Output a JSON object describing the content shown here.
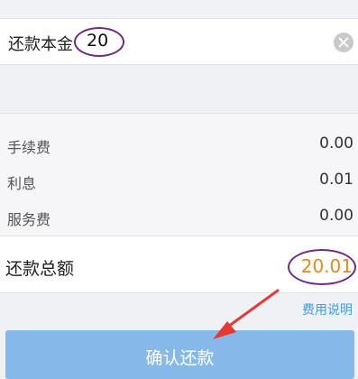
{
  "principal": {
    "label": "还款本金",
    "value": "20",
    "clear_icon": "clear-icon"
  },
  "fees": {
    "items": [
      {
        "label": "手续费",
        "value": "0.00"
      },
      {
        "label": "利息",
        "value": "0.01"
      },
      {
        "label": "服务费",
        "value": "0.00"
      }
    ]
  },
  "total": {
    "label": "还款总额",
    "value": "20.01",
    "value_color": "#e68a19"
  },
  "links": {
    "fee_explain": "费用说明"
  },
  "actions": {
    "confirm_label": "确认还款"
  },
  "annotations": {
    "highlight_color": "#6f2a86",
    "arrow_color": "#e53935"
  }
}
